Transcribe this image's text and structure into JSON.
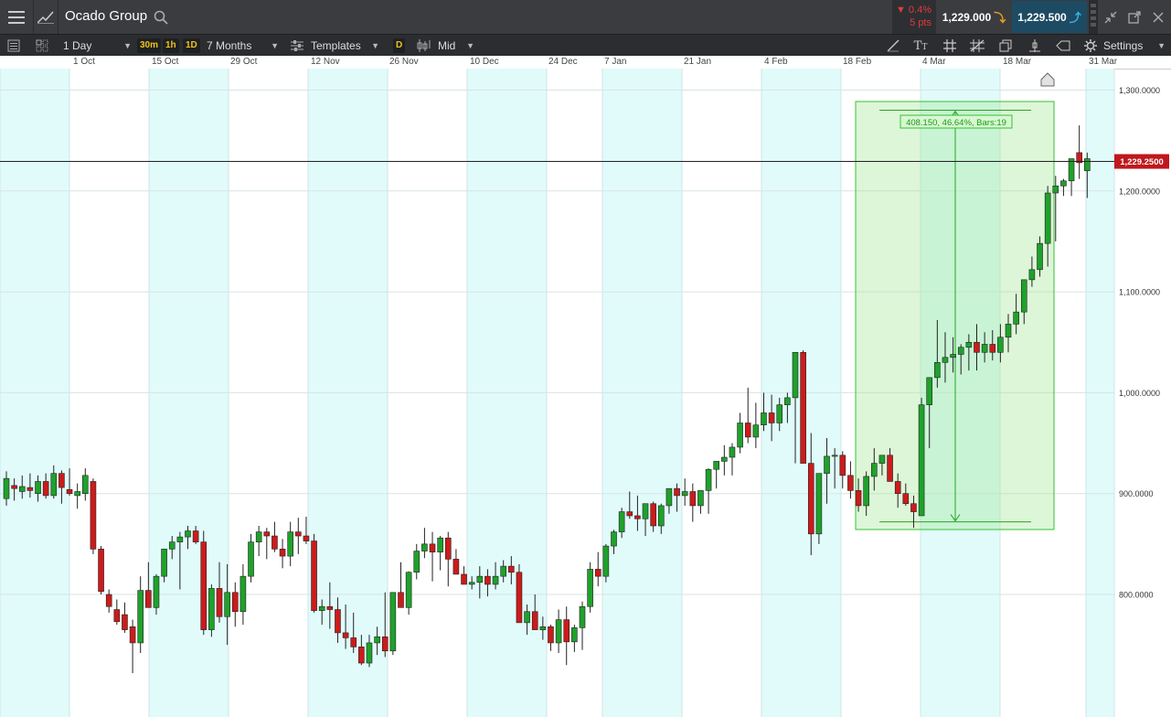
{
  "instrument": {
    "name": "Ocado Group"
  },
  "quote": {
    "change_pct": "0.4%",
    "change_pts": "5 pts",
    "sell": "1,229.000",
    "buy": "1,229.500"
  },
  "toolbar": {
    "interval": "1 Day",
    "quick_30m": "30m",
    "quick_1h": "1h",
    "quick_1d": "1D",
    "range": "7 Months",
    "templates": "Templates",
    "d_badge": "D",
    "price_type": "Mid",
    "settings": "Settings"
  },
  "date_labels": [
    "1 Oct",
    "15 Oct",
    "29 Oct",
    "12 Nov",
    "26 Nov",
    "10 Dec",
    "24 Dec",
    "7 Jan",
    "21 Jan",
    "4 Feb",
    "18 Feb",
    "4 Mar",
    "18 Mar",
    "31 Mar"
  ],
  "measure": {
    "label": "408.150, 46.64%, Bars:19"
  },
  "current_price": "1,229.2500",
  "colors": {
    "up": "#1fa12b",
    "down": "#cc1b1b",
    "band": "#e1fbfb",
    "measure_fill": "#9fe58f",
    "price_tag": "#c0171c"
  },
  "icons": {
    "menu": "hamburger-icon",
    "search": "search-icon",
    "settings": "gear-icon"
  },
  "chart_data": {
    "type": "candlestick",
    "x_unit": "trading day",
    "y_axis": {
      "ticks": [
        "800.0000",
        "900.0000",
        "1,000.0000",
        "1,100.0000",
        "1,200.0000",
        "1,300.0000"
      ],
      "range": [
        720,
        1345
      ]
    },
    "start_date": "2018-09-19",
    "last_date": "2019-03-22",
    "ohlc_note": "[open, high, low, close] per trading day",
    "candles": [
      [
        895,
        922,
        888,
        915
      ],
      [
        908,
        915,
        893,
        905
      ],
      [
        902,
        918,
        895,
        907
      ],
      [
        906,
        920,
        896,
        903
      ],
      [
        900,
        918,
        892,
        912
      ],
      [
        912,
        920,
        895,
        898
      ],
      [
        898,
        928,
        895,
        920
      ],
      [
        920,
        923,
        890,
        906
      ],
      [
        904,
        925,
        898,
        900
      ],
      [
        898,
        910,
        885,
        902
      ],
      [
        900,
        925,
        893,
        918
      ],
      [
        912,
        915,
        840,
        845
      ],
      [
        845,
        848,
        800,
        803
      ],
      [
        800,
        805,
        782,
        788
      ],
      [
        785,
        795,
        770,
        773
      ],
      [
        780,
        792,
        762,
        765
      ],
      [
        768,
        775,
        722,
        752
      ],
      [
        752,
        818,
        742,
        804
      ],
      [
        804,
        832,
        795,
        787
      ],
      [
        787,
        820,
        780,
        818
      ],
      [
        818,
        845,
        812,
        845
      ],
      [
        845,
        858,
        835,
        852
      ],
      [
        852,
        862,
        805,
        857
      ],
      [
        857,
        868,
        845,
        863
      ],
      [
        863,
        868,
        850,
        852
      ],
      [
        852,
        863,
        760,
        765
      ],
      [
        765,
        810,
        758,
        806
      ],
      [
        806,
        832,
        772,
        778
      ],
      [
        778,
        830,
        750,
        802
      ],
      [
        802,
        812,
        768,
        783
      ],
      [
        783,
        830,
        770,
        818
      ],
      [
        818,
        860,
        812,
        852
      ],
      [
        852,
        868,
        838,
        862
      ],
      [
        862,
        866,
        835,
        858
      ],
      [
        858,
        872,
        842,
        845
      ],
      [
        845,
        855,
        826,
        838
      ],
      [
        838,
        872,
        828,
        862
      ],
      [
        862,
        876,
        840,
        858
      ],
      [
        858,
        877,
        850,
        853
      ],
      [
        853,
        860,
        782,
        784
      ],
      [
        784,
        795,
        770,
        788
      ],
      [
        788,
        812,
        766,
        785
      ],
      [
        785,
        797,
        752,
        762
      ],
      [
        762,
        790,
        746,
        757
      ],
      [
        757,
        782,
        742,
        748
      ],
      [
        748,
        760,
        730,
        732
      ],
      [
        732,
        760,
        728,
        752
      ],
      [
        752,
        768,
        740,
        758
      ],
      [
        758,
        802,
        738,
        744
      ],
      [
        744,
        802,
        740,
        802
      ],
      [
        802,
        832,
        788,
        787
      ],
      [
        787,
        823,
        780,
        822
      ],
      [
        822,
        850,
        815,
        843
      ],
      [
        843,
        866,
        836,
        850
      ],
      [
        850,
        862,
        813,
        842
      ],
      [
        842,
        858,
        824,
        856
      ],
      [
        856,
        862,
        808,
        835
      ],
      [
        835,
        845,
        822,
        820
      ],
      [
        820,
        828,
        810,
        810
      ],
      [
        810,
        818,
        805,
        812
      ],
      [
        812,
        828,
        796,
        818
      ],
      [
        818,
        825,
        798,
        810
      ],
      [
        810,
        832,
        805,
        818
      ],
      [
        818,
        834,
        812,
        828
      ],
      [
        828,
        838,
        810,
        822
      ],
      [
        822,
        830,
        772,
        772
      ],
      [
        772,
        790,
        760,
        783
      ],
      [
        783,
        800,
        768,
        765
      ],
      [
        765,
        778,
        755,
        768
      ],
      [
        768,
        770,
        744,
        752
      ],
      [
        752,
        785,
        742,
        775
      ],
      [
        775,
        788,
        730,
        753
      ],
      [
        753,
        770,
        743,
        767
      ],
      [
        767,
        793,
        745,
        788
      ],
      [
        788,
        832,
        782,
        825
      ],
      [
        825,
        842,
        808,
        818
      ],
      [
        818,
        850,
        812,
        848
      ],
      [
        848,
        864,
        840,
        862
      ],
      [
        862,
        886,
        856,
        882
      ],
      [
        882,
        902,
        875,
        878
      ],
      [
        878,
        898,
        863,
        875
      ],
      [
        875,
        890,
        858,
        890
      ],
      [
        890,
        892,
        862,
        868
      ],
      [
        868,
        890,
        860,
        888
      ],
      [
        888,
        905,
        880,
        905
      ],
      [
        905,
        910,
        882,
        898
      ],
      [
        898,
        915,
        888,
        902
      ],
      [
        902,
        910,
        872,
        888
      ],
      [
        888,
        900,
        880,
        903
      ],
      [
        903,
        925,
        880,
        924
      ],
      [
        924,
        930,
        905,
        932
      ],
      [
        932,
        948,
        918,
        936
      ],
      [
        936,
        950,
        918,
        946
      ],
      [
        946,
        980,
        940,
        970
      ],
      [
        970,
        1005,
        950,
        956
      ],
      [
        956,
        990,
        945,
        968
      ],
      [
        968,
        1000,
        962,
        980
      ],
      [
        980,
        998,
        952,
        970
      ],
      [
        970,
        995,
        962,
        988
      ],
      [
        988,
        1000,
        970,
        995
      ],
      [
        995,
        1040,
        930,
        1040
      ],
      [
        1040,
        1042,
        935,
        930
      ],
      [
        930,
        960,
        839,
        860
      ],
      [
        860,
        920,
        850,
        920
      ],
      [
        920,
        955,
        890,
        937
      ],
      [
        937,
        945,
        905,
        938
      ],
      [
        938,
        942,
        905,
        918
      ],
      [
        918,
        932,
        895,
        903
      ],
      [
        903,
        915,
        882,
        888
      ],
      [
        888,
        922,
        878,
        917
      ],
      [
        917,
        945,
        903,
        930
      ],
      [
        930,
        935,
        918,
        938
      ],
      [
        938,
        945,
        915,
        912
      ],
      [
        912,
        920,
        886,
        900
      ],
      [
        900,
        910,
        888,
        890
      ],
      [
        890,
        898,
        866,
        882
      ],
      [
        878,
        995,
        878,
        988
      ],
      [
        988,
        1002,
        945,
        1015
      ],
      [
        1015,
        1072,
        1005,
        1030
      ],
      [
        1030,
        1060,
        1010,
        1035
      ],
      [
        1035,
        1055,
        1020,
        1038
      ],
      [
        1038,
        1048,
        1018,
        1045
      ],
      [
        1045,
        1058,
        1022,
        1050
      ],
      [
        1050,
        1068,
        1022,
        1040
      ],
      [
        1040,
        1060,
        1030,
        1048
      ],
      [
        1048,
        1062,
        1032,
        1040
      ],
      [
        1040,
        1068,
        1030,
        1055
      ],
      [
        1055,
        1078,
        1040,
        1068
      ],
      [
        1068,
        1098,
        1058,
        1080
      ],
      [
        1080,
        1110,
        1068,
        1112
      ],
      [
        1112,
        1135,
        1105,
        1122
      ],
      [
        1122,
        1155,
        1115,
        1148
      ],
      [
        1148,
        1205,
        1125,
        1198
      ],
      [
        1198,
        1215,
        1150,
        1205
      ],
      [
        1205,
        1212,
        1195,
        1210
      ],
      [
        1210,
        1230,
        1195,
        1232
      ],
      [
        1238,
        1265,
        1212,
        1228
      ],
      [
        1220,
        1238,
        1193,
        1232
      ]
    ],
    "measure": {
      "start_value": 872,
      "end_value": 1280,
      "change": "408.150",
      "change_pct": "46.64%",
      "bars": 19
    },
    "last_price": "1,229.2500"
  }
}
